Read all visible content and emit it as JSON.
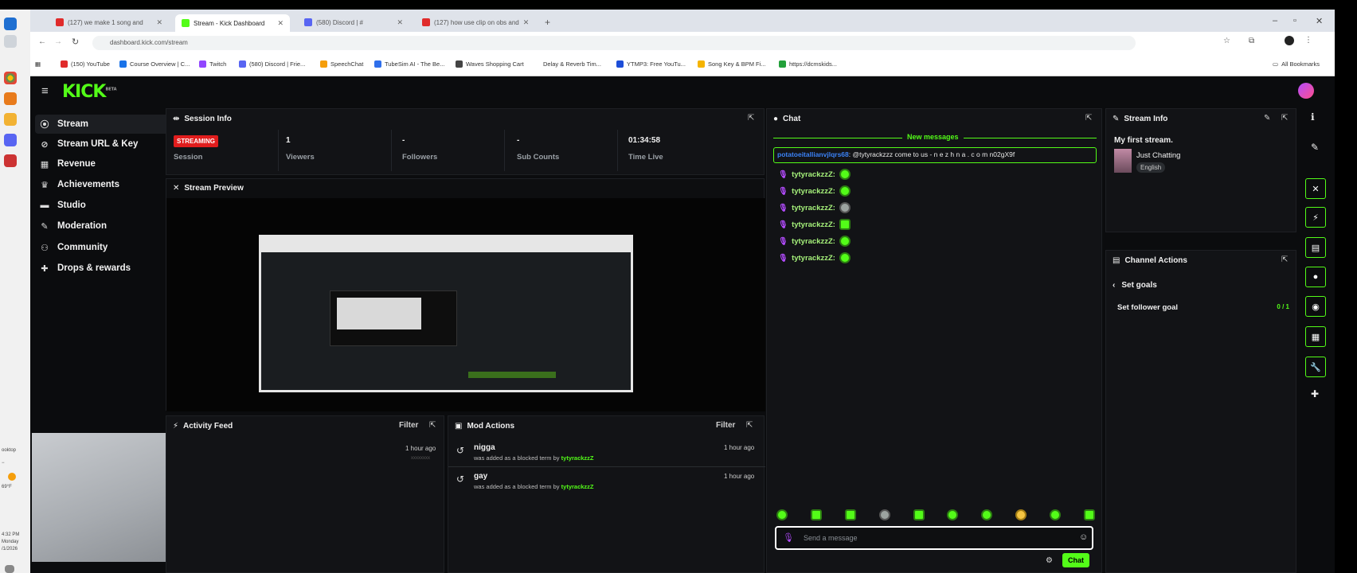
{
  "taskbar": {
    "side_labels": [
      "ooktop",
      "−"
    ],
    "weather": "69°F",
    "clock": {
      "time": "4:32 PM",
      "day": "Monday",
      "date": "/1/2026"
    }
  },
  "browser": {
    "tabs": [
      {
        "label": "(127) we make 1 song and",
        "active": false,
        "color": "#e02b2b"
      },
      {
        "label": "Stream - Kick Dashboard",
        "active": true,
        "color": "#53fc18"
      },
      {
        "label": "(580) Discord | #",
        "active": false,
        "color": "#5865f2"
      },
      {
        "label": "(127) how use clip on obs and",
        "active": false,
        "color": "#e02b2b"
      }
    ],
    "new_tab": "+",
    "url": "dashboard.kick.com/stream",
    "bookmarks": [
      {
        "label": "(150) YouTube",
        "color": "#e02b2b"
      },
      {
        "label": "Course Overview | C...",
        "color": "#1a73e8"
      },
      {
        "label": "Twitch",
        "color": "#9146ff"
      },
      {
        "label": "(580) Discord | Frie...",
        "color": "#5865f2"
      },
      {
        "label": "SpeechChat",
        "color": "#f59e0b"
      },
      {
        "label": "TubeSim AI - The Be...",
        "color": "#2f6feb"
      },
      {
        "label": "Waves Shopping Cart",
        "color": "#444444"
      },
      {
        "label": "Delay & Reverb Tim...",
        "color": "#888888"
      },
      {
        "label": "YTMP3: Free YouTu...",
        "color": "#1d4ed8"
      },
      {
        "label": "Song Key & BPM Fi...",
        "color": "#f5b400"
      },
      {
        "label": "https://dcmskids...",
        "color": "#22a03a"
      }
    ],
    "all_bookmarks": "All Bookmarks"
  },
  "kick": {
    "logo": "KICK",
    "logo_sub": "BETA",
    "sidebar": [
      {
        "label": "Stream",
        "icon": "broadcast-icon",
        "glyph": "((·))",
        "active": true
      },
      {
        "label": "Stream URL & Key",
        "icon": "link-icon",
        "glyph": "🔗"
      },
      {
        "label": "Revenue",
        "icon": "chart-icon",
        "glyph": "▮"
      },
      {
        "label": "Achievements",
        "icon": "trophy-icon",
        "glyph": "🏆"
      },
      {
        "label": "Studio",
        "icon": "studio-icon",
        "glyph": "▭",
        "expandable": true
      },
      {
        "label": "Moderation",
        "icon": "wrench-icon",
        "glyph": "🔧"
      },
      {
        "label": "Community",
        "icon": "community-icon",
        "glyph": "👥",
        "expandable": true
      },
      {
        "label": "Drops & rewards",
        "icon": "gift-icon",
        "glyph": "🎁"
      }
    ],
    "session": {
      "title": "Session Info",
      "badge": "STREAMING",
      "badge_label": "Session",
      "stats": [
        {
          "value": "1",
          "label": "Viewers"
        },
        {
          "value": "-",
          "label": "Followers"
        },
        {
          "value": "-",
          "label": "Sub Counts"
        },
        {
          "value": "01:34:58",
          "label": "Time Live"
        }
      ]
    },
    "preview": {
      "title": "Stream Preview"
    },
    "activity": {
      "title": "Activity Feed",
      "filter": "Filter",
      "items": [
        {
          "time": "1 hour ago",
          "sub": "xxxxxxxx"
        }
      ]
    },
    "mod_actions": {
      "title": "Mod Actions",
      "filter": "Filter",
      "items": [
        {
          "term": "nigga",
          "text": "was added as a blocked term by",
          "user": "tytyrackzzZ",
          "time": "1 hour ago"
        },
        {
          "term": "gay",
          "text": "was added as a blocked term by",
          "user": "tytyrackzzZ",
          "time": "1 hour ago"
        }
      ]
    },
    "chat": {
      "title": "Chat",
      "new_messages": "New messages",
      "highlight": {
        "user": "potatoeitallianvjlqrs68",
        "text": "@tytyrackzzz come to us - n e z h n a . c o m n02gX9f"
      },
      "messages": [
        {
          "user": "tytyrackzzZ:",
          "emote": "round"
        },
        {
          "user": "tytyrackzzZ:",
          "emote": "round"
        },
        {
          "user": "tytyrackzzZ:",
          "emote": "gray"
        },
        {
          "user": "tytyrackzzZ:",
          "emote": "square"
        },
        {
          "user": "tytyrackzzZ:",
          "emote": "round"
        },
        {
          "user": "tytyrackzzZ:",
          "emote": "round"
        }
      ],
      "input_placeholder": "Send a message",
      "send": "Chat"
    },
    "stream_info": {
      "title": "Stream Info",
      "stream_title": "My first stream.",
      "category": "Just Chatting",
      "language": "English"
    },
    "channel_actions": {
      "title": "Channel Actions",
      "back": "Set goals",
      "goal_label": "Set follower goal",
      "goal_value": "0 / 1"
    },
    "accent": "#53fc18"
  }
}
